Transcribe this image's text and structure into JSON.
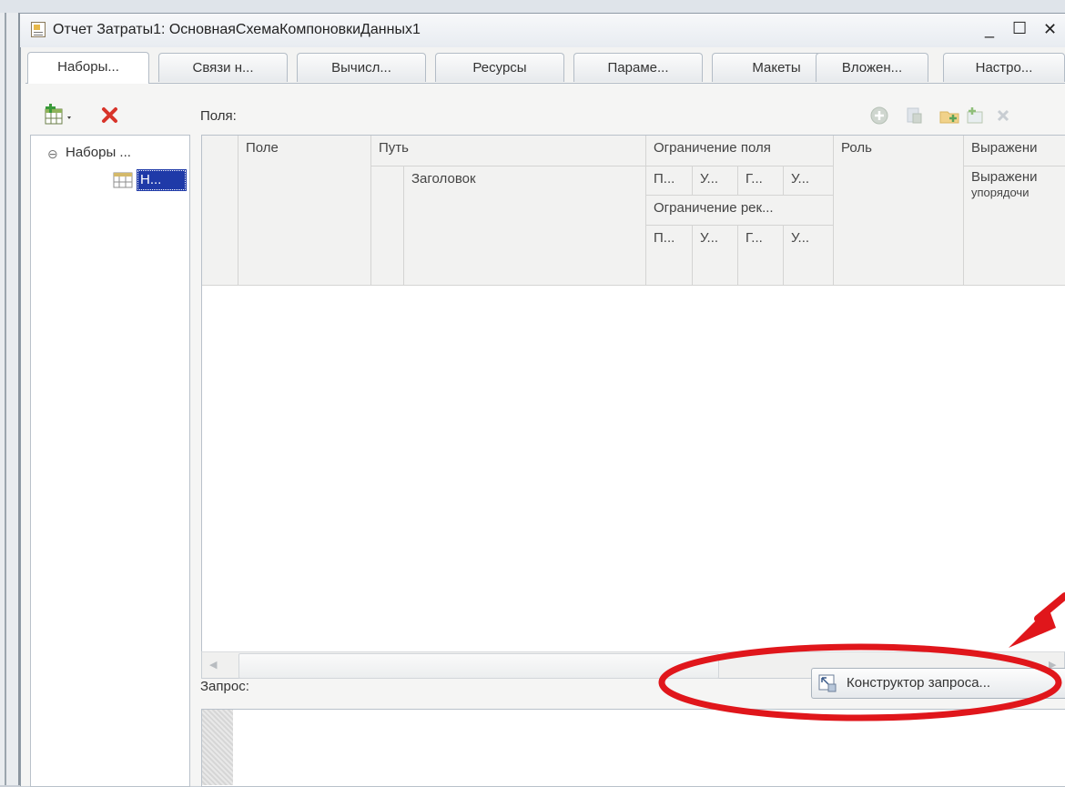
{
  "window": {
    "title": "Отчет Затраты1: ОсновнаяСхемаКомпоновкиДанных1",
    "minimize": "_",
    "maximize": "☐",
    "close": "✕"
  },
  "tabs": [
    {
      "label": "Наборы..."
    },
    {
      "label": "Связи н..."
    },
    {
      "label": "Вычисл..."
    },
    {
      "label": "Ресурсы"
    },
    {
      "label": "Параме..."
    },
    {
      "label": "Макеты"
    },
    {
      "label": "Вложен..."
    },
    {
      "label": "Настро..."
    }
  ],
  "tree": {
    "root_label": "Наборы ...",
    "child_label": "Н..."
  },
  "fields": {
    "label": "Поля:",
    "columns": {
      "field": "Поле",
      "path": "Путь",
      "title": "Заголовок",
      "field_restriction": "Ограничение поля",
      "attr_restriction": "Ограничение рек...",
      "role": "Роль",
      "expression": "Выражени",
      "expression_order": "Выражени",
      "expression_order2": "упорядочи"
    },
    "sub": [
      "П...",
      "У...",
      "Г...",
      "У..."
    ]
  },
  "query": {
    "label": "Запрос:",
    "constructor_button": "Конструктор запроса..."
  },
  "colors": {
    "annotation": "#e0161b",
    "selection": "#1f3aa8"
  }
}
